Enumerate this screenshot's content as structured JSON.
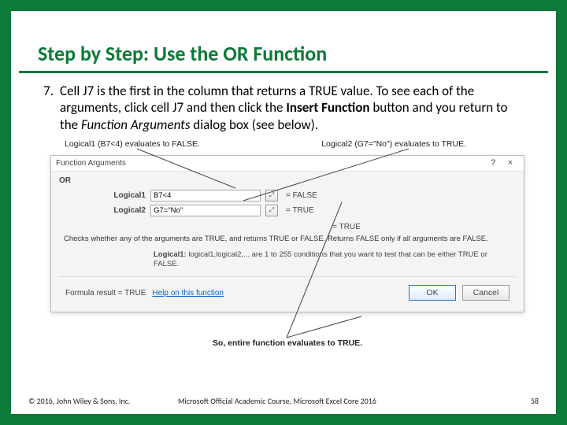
{
  "title": "Step by Step: Use the OR Function",
  "step": {
    "number": "7.",
    "text_a": "Cell J7 is the first in the column that returns a TRUE value. To see each of the arguments, click cell J7 and then click the ",
    "bold": "Insert Function",
    "text_b": " button and you return to the ",
    "italic": "Function Arguments",
    "text_c": " dialog box (see below)."
  },
  "callouts": {
    "left": "Logical1 (B7<4) evaluates to FALSE.",
    "right": "Logical2 (G7=\"No\") evaluates to TRUE.",
    "bottom": "So, entire function evaluates to TRUE."
  },
  "dialog": {
    "title": "Function Arguments",
    "help_btn": "?",
    "close_btn": "×",
    "fn_name": "OR",
    "args": [
      {
        "label": "Logical1",
        "value": "B7<4",
        "range_icon": "⤢",
        "result": "= FALSE"
      },
      {
        "label": "Logical2",
        "value": "G7=\"No\"",
        "range_icon": "⤢",
        "result": "= TRUE"
      }
    ],
    "overall_eq": "= TRUE",
    "description": "Checks whether any of the arguments are TRUE, and returns TRUE or FALSE. Returns FALSE only if all arguments are FALSE.",
    "hint_label": "Logical1:",
    "hint_text": " logical1,logical2,... are 1 to 255 conditions that you want to test that can be either TRUE or FALSE.",
    "formula_result_label": "Formula result =",
    "formula_result_value": "TRUE",
    "help_link": "Help on this function",
    "ok": "OK",
    "cancel": "Cancel"
  },
  "footer": {
    "copyright": "© 2016, John Wiley & Sons, Inc.",
    "course": "Microsoft Official Academic Course, Microsoft Excel Core 2016",
    "page": "58"
  }
}
